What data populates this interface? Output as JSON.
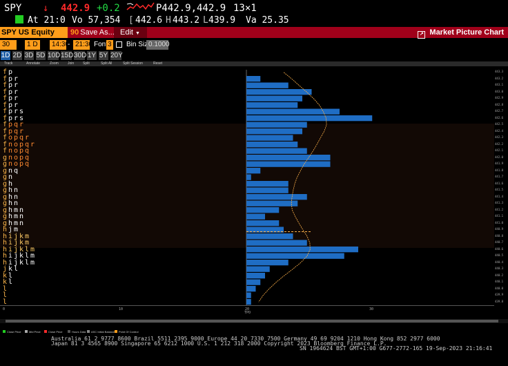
{
  "quote": {
    "ticker": "SPY",
    "last": "442.9",
    "change": "+0.2",
    "price_pair": "P442.9,442.9",
    "size": "13×1",
    "flag_time": "At 21:0",
    "volume": "Vo 57,354",
    "open": "442.6",
    "high": "443.2",
    "low": "439.9",
    "vwap": "Va 25.35"
  },
  "toolbar": {
    "security": "SPY US Equity",
    "save_num": "90",
    "save_label": "Save As...",
    "edit_label": "Edit",
    "title": "Market Picture Chart"
  },
  "controls": {
    "bar_size": "30 Min",
    "period": "1 D",
    "start_time": "14:30",
    "end_time": "21:30",
    "font_label": "Font",
    "font_size": "3",
    "bin_label": "Bin Size",
    "bin_value": "0.1000"
  },
  "range_buttons": [
    "1D",
    "2D",
    "3D",
    "5D",
    "10D",
    "15D",
    "30D",
    "1Y",
    "5Y",
    "20Y"
  ],
  "annotation_tools": [
    "Track",
    "Annotate",
    "Zoom",
    "Join",
    "Split",
    "Split All",
    "Split Session",
    "Reset"
  ],
  "colors": {
    "accent_orange": "#ff9d1a",
    "toolbar_red": "#a0001a",
    "bar_blue": "#1f6dc4",
    "price_red": "#ff2a2a",
    "change_green": "#22dd44"
  },
  "tpo_rows": [
    [
      "f",
      "p"
    ],
    [
      "f",
      "p",
      "r"
    ],
    [
      "f",
      "p",
      "r"
    ],
    [
      "f",
      "p",
      "r"
    ],
    [
      "f",
      "p",
      "r"
    ],
    [
      "f",
      "p",
      "r"
    ],
    [
      "f",
      "p",
      "r",
      "s"
    ],
    [
      "f",
      "p",
      "r",
      "s"
    ],
    [
      "f",
      "p",
      "q",
      "r"
    ],
    [
      "f",
      "p",
      "q",
      "r"
    ],
    [
      "f",
      "o",
      "p",
      "q",
      "r"
    ],
    [
      "f",
      "n",
      "o",
      "p",
      "q",
      "r"
    ],
    [
      "f",
      "n",
      "o",
      "p",
      "q"
    ],
    [
      "g",
      "n",
      "o",
      "p",
      "q"
    ],
    [
      "g",
      "n",
      "o",
      "p",
      "q"
    ],
    [
      "g",
      "n",
      "q"
    ],
    [
      "g",
      "n"
    ],
    [
      "g",
      "h"
    ],
    [
      "g",
      "h",
      "n"
    ],
    [
      "g",
      "h",
      "n"
    ],
    [
      "g",
      "h",
      "n"
    ],
    [
      "g",
      "h",
      "m",
      "n"
    ],
    [
      "g",
      "h",
      "m",
      "n"
    ],
    [
      "g",
      "h",
      "m",
      "n"
    ],
    [
      "h",
      "j",
      "m"
    ],
    [
      "h",
      "i",
      "j",
      "k",
      "m"
    ],
    [
      "h",
      "i",
      "j",
      "k",
      "m"
    ],
    [
      "h",
      "i",
      "j",
      "k",
      "l",
      "m"
    ],
    [
      "h",
      "i",
      "j",
      "k",
      "l",
      "m"
    ],
    [
      "h",
      "i",
      "j",
      "k",
      "l",
      "m"
    ],
    [
      "j",
      "k",
      "l"
    ],
    [
      "k",
      "l"
    ],
    [
      "k",
      "l"
    ],
    [
      "l"
    ],
    [
      "l"
    ],
    [
      "l"
    ]
  ],
  "chart_data": {
    "type": "bar",
    "orientation": "horizontal",
    "bin_size": 0.1,
    "values": [
      0,
      3,
      9,
      14,
      12,
      11,
      20,
      27,
      13,
      12,
      10,
      11,
      13,
      18,
      18,
      3,
      1,
      9,
      9,
      13,
      11,
      7,
      4,
      7,
      8,
      10,
      13,
      24,
      21,
      9,
      5,
      4,
      3,
      2,
      1,
      1
    ],
    "value_area_rows": [
      8,
      27
    ],
    "poc_row": 25,
    "xlim": [
      0,
      40
    ],
    "x_ticks": [
      "0",
      "10",
      "20",
      "30"
    ],
    "x_label": "TPO",
    "y_ticks": [
      "443.3",
      "443.2",
      "443.1",
      "443.0",
      "442.9",
      "442.8",
      "442.7",
      "442.6",
      "442.5",
      "442.4",
      "442.3",
      "442.2",
      "442.1",
      "442.0",
      "441.9",
      "441.8",
      "441.7",
      "441.6",
      "441.5",
      "441.4",
      "441.3",
      "441.2",
      "441.1",
      "441.0",
      "440.9",
      "440.8",
      "440.7",
      "440.6",
      "440.5",
      "440.4",
      "440.3",
      "440.2",
      "440.1",
      "440.0",
      "439.9",
      "439.8"
    ]
  },
  "legend": [
    "Close Price",
    "Mid Price",
    "Close Price",
    "Hours Data",
    "ASC Initial Balance",
    "Point Of Control"
  ],
  "footer": {
    "line1": "Australia 61 2 9777 8600 Brazil 5511 2395 9000 Europe 44 20 7330 7500 Germany 49 69 9204 1210 Hong Kong 852 2977 6000",
    "line2": "Japan 81 3 4565 8900         Singapore 65 6212 1000      U.S. 1 212 318 2000          Copyright 2023 Bloomberg Finance L.P.",
    "line3": "SN 1964624 BST  GMT+1:00 G677-2772-165 19-Sep-2023 21:16:41"
  }
}
